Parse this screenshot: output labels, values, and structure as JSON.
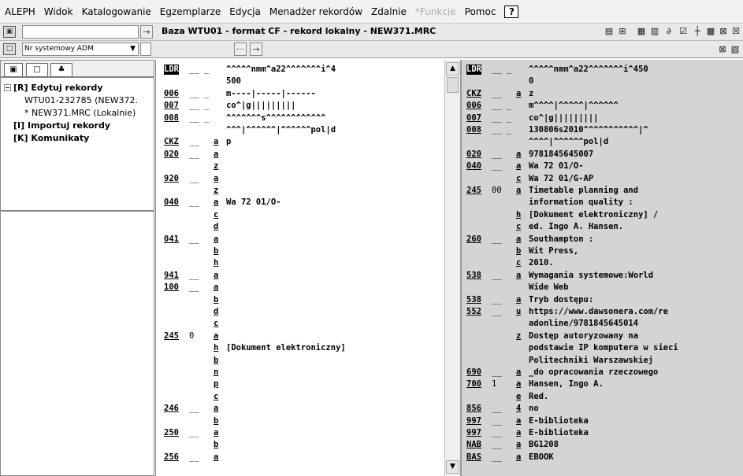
{
  "menu": [
    "ALEPH",
    "Widok",
    "Katalogowanie",
    "Egzemplarze",
    "Edycja",
    "Menadżer rekordów",
    "Zdalnie",
    "*Funkcje",
    "Pomoc"
  ],
  "menu_disabled": [
    "*Funkcje"
  ],
  "help_label": "?",
  "header_title": "Baza WTU01 - format CF - rekord lokalny - NEW371.MRC",
  "search_select": "Nr systemowy ADM",
  "tree": [
    {
      "label": "[R] Edytuj rekordy",
      "bold": true,
      "expander": "-"
    },
    {
      "label": "WTU01-232785 (NEW372.",
      "bold": false
    },
    {
      "label": "* NEW371.MRC (Lokalnie)",
      "bold": false
    },
    {
      "label": "[I] Importuj rekordy",
      "bold": true
    },
    {
      "label": "[K] Komunikaty",
      "bold": true
    }
  ],
  "mid_lines": [
    {
      "tag": "LDR",
      "ind": "__ _",
      "sub": "",
      "val": "^^^^^nmm^a22^^^^^^^i^4",
      "ldr": true
    },
    {
      "tag": "",
      "ind": "",
      "sub": "",
      "val": "500"
    },
    {
      "tag": "006",
      "ind": "__ _",
      "sub": "",
      "val": "m----|-----|------"
    },
    {
      "tag": "007",
      "ind": "__ _",
      "sub": "",
      "val": "co^|g|||||||||"
    },
    {
      "tag": "008",
      "ind": "__ _",
      "sub": "",
      "val": "^^^^^^^s^^^^^^^^^^^^"
    },
    {
      "tag": "",
      "ind": "",
      "sub": "",
      "val": "^^^|^^^^^^|^^^^^^pol|d"
    },
    {
      "tag": "CKZ",
      "ind": "__",
      "sub": "a",
      "val": "p"
    },
    {
      "tag": "020",
      "ind": "__",
      "sub": "a",
      "val": ""
    },
    {
      "tag": "",
      "ind": "",
      "sub": "z",
      "val": ""
    },
    {
      "tag": "920",
      "ind": "__",
      "sub": "a",
      "val": ""
    },
    {
      "tag": "",
      "ind": "",
      "sub": "z",
      "val": ""
    },
    {
      "tag": "040",
      "ind": "__",
      "sub": "a",
      "val": "Wa 72 01/O-"
    },
    {
      "tag": "",
      "ind": "",
      "sub": "c",
      "val": ""
    },
    {
      "tag": "",
      "ind": "",
      "sub": "d",
      "val": ""
    },
    {
      "tag": "041",
      "ind": "__",
      "sub": "a",
      "val": ""
    },
    {
      "tag": "",
      "ind": "",
      "sub": "b",
      "val": ""
    },
    {
      "tag": "",
      "ind": "",
      "sub": "h",
      "val": ""
    },
    {
      "tag": "941",
      "ind": "__",
      "sub": "a",
      "val": ""
    },
    {
      "tag": "100",
      "ind": "__",
      "sub": "a",
      "val": ""
    },
    {
      "tag": "",
      "ind": "",
      "sub": "b",
      "val": ""
    },
    {
      "tag": "",
      "ind": "",
      "sub": "d",
      "val": ""
    },
    {
      "tag": "",
      "ind": "",
      "sub": "c",
      "val": ""
    },
    {
      "tag": "245",
      "ind": "0",
      "sub": "a",
      "val": ""
    },
    {
      "tag": "",
      "ind": "",
      "sub": "h",
      "val": "[Dokument elektroniczny]"
    },
    {
      "tag": "",
      "ind": "",
      "sub": "b",
      "val": ""
    },
    {
      "tag": "",
      "ind": "",
      "sub": "n",
      "val": ""
    },
    {
      "tag": "",
      "ind": "",
      "sub": "p",
      "val": ""
    },
    {
      "tag": "",
      "ind": "",
      "sub": "c",
      "val": ""
    },
    {
      "tag": "246",
      "ind": "__",
      "sub": "a",
      "val": ""
    },
    {
      "tag": "",
      "ind": "",
      "sub": "b",
      "val": ""
    },
    {
      "tag": "250",
      "ind": "__",
      "sub": "a",
      "val": ""
    },
    {
      "tag": "",
      "ind": "",
      "sub": "b",
      "val": ""
    },
    {
      "tag": "256",
      "ind": "__",
      "sub": "a",
      "val": ""
    }
  ],
  "right_lines": [
    {
      "tag": "LDR",
      "ind": "__ _",
      "sub": "",
      "val": "^^^^^nmm^a22^^^^^^^i^450",
      "ldr": true
    },
    {
      "tag": "",
      "ind": "",
      "sub": "",
      "val": "0"
    },
    {
      "tag": "CKZ",
      "ind": "__",
      "sub": "a",
      "val": "z"
    },
    {
      "tag": "006",
      "ind": "__ _",
      "sub": "",
      "val": "m^^^^|^^^^^|^^^^^^"
    },
    {
      "tag": "007",
      "ind": "__ _",
      "sub": "",
      "val": "co^|g|||||||||"
    },
    {
      "tag": "008",
      "ind": "__ _",
      "sub": "",
      "val": "130806s2010^^^^^^^^^^^|^"
    },
    {
      "tag": "",
      "ind": "",
      "sub": "",
      "val": "^^^^|^^^^^^pol|d"
    },
    {
      "tag": "020",
      "ind": "__",
      "sub": "a",
      "val": "9781845645007"
    },
    {
      "tag": "040",
      "ind": "__",
      "sub": "a",
      "val": "Wa 72 01/O-"
    },
    {
      "tag": "",
      "ind": "",
      "sub": "c",
      "val": "Wa 72 01/G-AP"
    },
    {
      "tag": "245",
      "ind": "00",
      "sub": "a",
      "val": "Timetable planning and"
    },
    {
      "tag": "",
      "ind": "",
      "sub": "",
      "val": "information quality :"
    },
    {
      "tag": "",
      "ind": "",
      "sub": "h",
      "val": "[Dokument elektroniczny] /"
    },
    {
      "tag": "",
      "ind": "",
      "sub": "c",
      "val": "ed. Ingo A. Hansen."
    },
    {
      "tag": "260",
      "ind": "__",
      "sub": "a",
      "val": "Southampton :"
    },
    {
      "tag": "",
      "ind": "",
      "sub": "b",
      "val": "Wit Press,"
    },
    {
      "tag": "",
      "ind": "",
      "sub": "c",
      "val": "2010."
    },
    {
      "tag": "538",
      "ind": "__",
      "sub": "a",
      "val": "Wymagania systemowe:World"
    },
    {
      "tag": "",
      "ind": "",
      "sub": "",
      "val": "Wide Web"
    },
    {
      "tag": "538",
      "ind": "__",
      "sub": "a",
      "val": "Tryb dostępu:"
    },
    {
      "tag": "552",
      "ind": "__",
      "sub": "u",
      "val": "https://www.dawsonera.com/re"
    },
    {
      "tag": "",
      "ind": "",
      "sub": "",
      "val": "adonline/9781845645014"
    },
    {
      "tag": "",
      "ind": "",
      "sub": "z",
      "val": "Dostęp autoryzowany na"
    },
    {
      "tag": "",
      "ind": "",
      "sub": "",
      "val": "podstawie IP komputera w sieci"
    },
    {
      "tag": "",
      "ind": "",
      "sub": "",
      "val": "Politechniki Warszawskiej"
    },
    {
      "tag": "690",
      "ind": "__",
      "sub": "a",
      "val": "_do opracowania rzeczowego"
    },
    {
      "tag": "700",
      "ind": "1",
      "sub": "a",
      "val": "Hansen, Ingo A."
    },
    {
      "tag": "",
      "ind": "",
      "sub": "e",
      "val": "Red."
    },
    {
      "tag": "856",
      "ind": "__",
      "sub": "4",
      "val": "no"
    },
    {
      "tag": "997",
      "ind": "__",
      "sub": "a",
      "val": "E-biblioteka"
    },
    {
      "tag": "997",
      "ind": "__",
      "sub": "a",
      "val": "E-biblioteka"
    },
    {
      "tag": "NAB",
      "ind": "__",
      "sub": "a",
      "val": "BG1208"
    },
    {
      "tag": "BAS",
      "ind": "__",
      "sub": "a",
      "val": "EBOOK"
    }
  ]
}
